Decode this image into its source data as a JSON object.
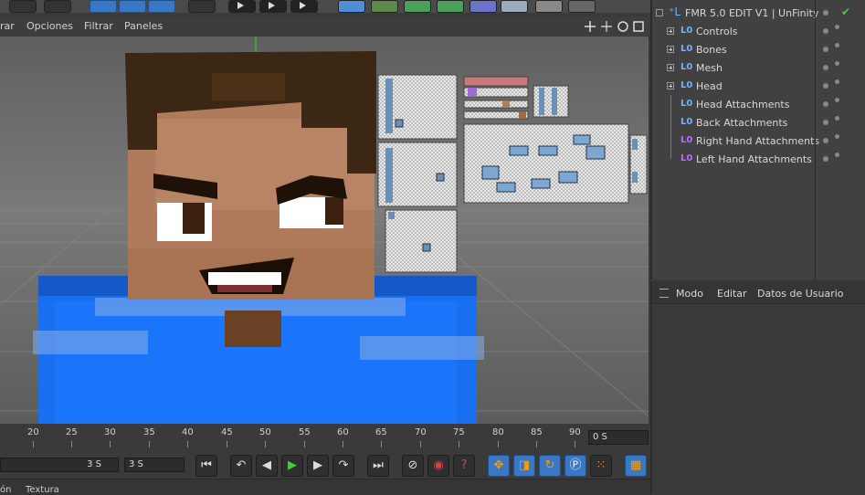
{
  "viewport_menu": [
    "rar",
    "Opciones",
    "Filtrar",
    "Paneles"
  ],
  "timeline": {
    "ticks": [
      "20",
      "25",
      "30",
      "35",
      "40",
      "45",
      "50",
      "55",
      "60",
      "65",
      "70",
      "75",
      "80",
      "85",
      "90"
    ],
    "current_frame": "0 S"
  },
  "playback": {
    "field_left_value": "3 S",
    "field_right_value": "3 S"
  },
  "bottom_menu": [
    "ón",
    "Textura"
  ],
  "object_manager": {
    "root": "FMR 5.0 EDIT V1 | UnFinity",
    "items": [
      {
        "label": "Controls",
        "expandable": true,
        "color": "blue"
      },
      {
        "label": "Bones",
        "expandable": true,
        "color": "blue"
      },
      {
        "label": "Mesh",
        "expandable": true,
        "color": "blue"
      },
      {
        "label": "Head",
        "expandable": true,
        "color": "blue"
      },
      {
        "label": "Head Attachments",
        "expandable": false,
        "color": "blue"
      },
      {
        "label": "Back Attachments",
        "expandable": false,
        "color": "blue"
      },
      {
        "label": "Right Hand Attachments",
        "expandable": false,
        "color": "purple"
      },
      {
        "label": "Left Hand Attachments",
        "expandable": false,
        "color": "purple"
      }
    ]
  },
  "attributes": {
    "menu": [
      "Modo",
      "Editar",
      "Datos de Usuario"
    ]
  },
  "colors": {
    "accent_blue": "#3b78c4",
    "orange": "#f39c12",
    "shirt_blue": "#1a6ef0",
    "skin": "#b07a5c",
    "hair": "#3b2713"
  }
}
